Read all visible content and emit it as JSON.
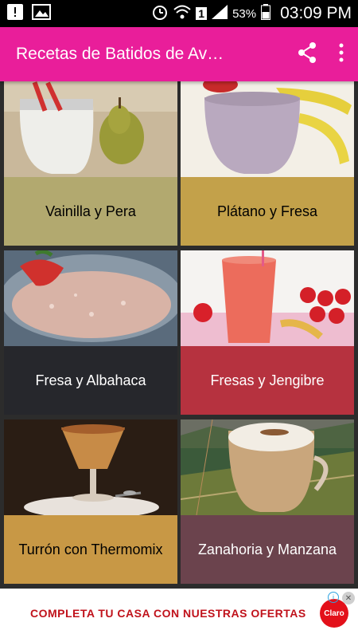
{
  "status_bar": {
    "battery": "53%",
    "time": "03:09 PM",
    "sim_label": "1"
  },
  "app_bar": {
    "title": "Recetas de Batidos de Av…",
    "share_icon": "share-icon",
    "menu_icon": "overflow-menu-icon"
  },
  "recipes": [
    {
      "label": "Vainilla y Pera",
      "label_bg": "#b2a96f"
    },
    {
      "label": "Plátano y Fresa",
      "label_bg": "#c3a14a"
    },
    {
      "label": "Fresa y Albahaca",
      "label_bg": "#26272c"
    },
    {
      "label": "Fresas y Jengibre",
      "label_bg": "#b6323f"
    },
    {
      "label": "Turrón con Thermomix",
      "label_bg": "#c89845"
    },
    {
      "label": "Zanahoria y Manzana",
      "label_bg": "#6b434d"
    }
  ],
  "ad": {
    "text": "COMPLETA TU CASA CON NUESTRAS OFERTAS",
    "brand": "Claro"
  }
}
